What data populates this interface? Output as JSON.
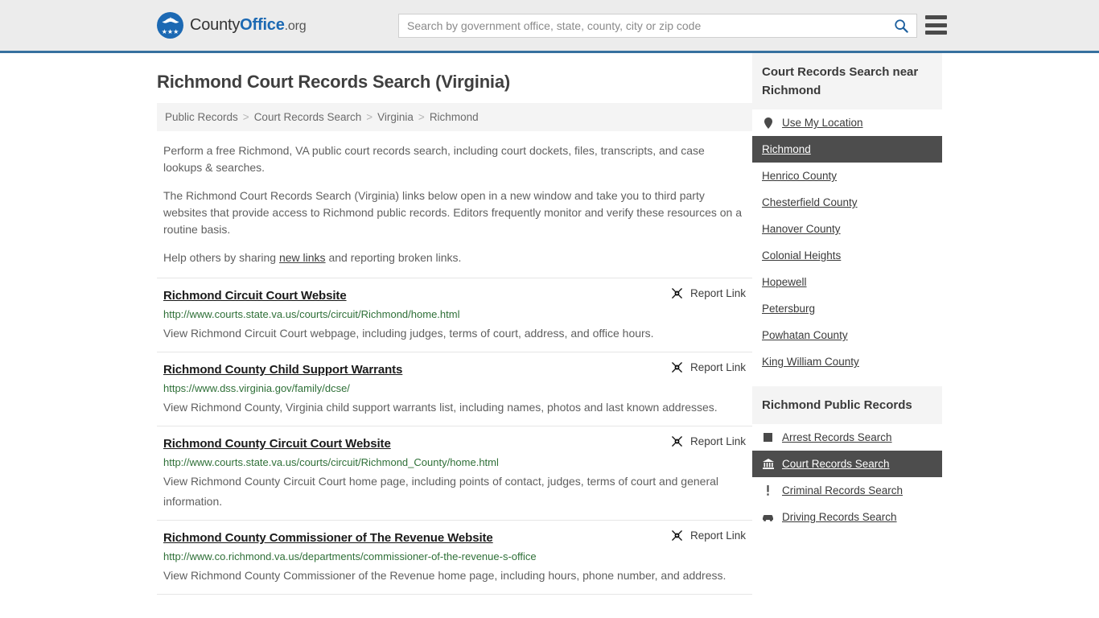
{
  "header": {
    "logo": {
      "text_county": "County",
      "text_office": "Office",
      "text_org": ".org",
      "icon": "eagle-shield-icon",
      "stars": "★★★"
    },
    "search": {
      "placeholder": "Search by government office, state, county, city or zip code",
      "value": "",
      "search_icon": "search-icon"
    },
    "menu_icon": "hamburger-menu-icon",
    "border_color": "#36709f",
    "background": "#ececec"
  },
  "page_title": "Richmond Court Records Search (Virginia)",
  "breadcrumb": {
    "items": [
      {
        "label": "Public Records"
      },
      {
        "label": "Court Records Search"
      },
      {
        "label": "Virginia"
      },
      {
        "label": "Richmond"
      }
    ],
    "separator": ">"
  },
  "intro": {
    "p1": "Perform a free Richmond, VA public court records search, including court dockets, files, transcripts, and case lookups & searches.",
    "p2": "The Richmond Court Records Search (Virginia) links below open in a new window and take you to third party websites that provide access to Richmond public records. Editors frequently monitor and verify these resources on a routine basis.",
    "p3_before": "Help others by sharing ",
    "p3_link": "new links",
    "p3_after": " and reporting broken links."
  },
  "results": {
    "report_label": "Report Link",
    "report_icon": "broken-link-icon",
    "items": [
      {
        "title": "Richmond Circuit Court Website",
        "url": "http://www.courts.state.va.us/courts/circuit/Richmond/home.html",
        "description": "View Richmond Circuit Court webpage, including judges, terms of court, address, and office hours."
      },
      {
        "title": "Richmond County Child Support Warrants",
        "url": "https://www.dss.virginia.gov/family/dcse/",
        "description": "View Richmond County, Virginia child support warrants list, including names, photos and last known addresses."
      },
      {
        "title": "Richmond County Circuit Court Website",
        "url": "http://www.courts.state.va.us/courts/circuit/Richmond_County/home.html",
        "description": "View Richmond County Circuit Court home page, including points of contact, judges, terms of court and general information."
      },
      {
        "title": "Richmond County Commissioner of The Revenue Website",
        "url": "http://www.co.richmond.va.us/departments/commissioner-of-the-revenue-s-office",
        "description": "View Richmond County Commissioner of the Revenue home page, including hours, phone number, and address."
      }
    ]
  },
  "sidebar": {
    "nearby": {
      "heading": "Court Records Search near Richmond",
      "items": [
        {
          "label": "Use My Location",
          "icon": "map-pin-icon",
          "active": false
        },
        {
          "label": "Richmond",
          "icon": "",
          "active": true
        },
        {
          "label": "Henrico County",
          "icon": "",
          "active": false
        },
        {
          "label": "Chesterfield County",
          "icon": "",
          "active": false
        },
        {
          "label": "Hanover County",
          "icon": "",
          "active": false
        },
        {
          "label": "Colonial Heights",
          "icon": "",
          "active": false
        },
        {
          "label": "Hopewell",
          "icon": "",
          "active": false
        },
        {
          "label": "Petersburg",
          "icon": "",
          "active": false
        },
        {
          "label": "Powhatan County",
          "icon": "",
          "active": false
        },
        {
          "label": "King William County",
          "icon": "",
          "active": false
        }
      ]
    },
    "public_records": {
      "heading": "Richmond Public Records",
      "items": [
        {
          "label": "Arrest Records Search",
          "icon": "square-icon",
          "active": false
        },
        {
          "label": "Court Records Search",
          "icon": "courthouse-icon",
          "active": true
        },
        {
          "label": "Criminal Records Search",
          "icon": "exclamation-icon",
          "active": false
        },
        {
          "label": "Driving Records Search",
          "icon": "car-icon",
          "active": false
        }
      ]
    },
    "active_background": "#4d4d4d"
  }
}
